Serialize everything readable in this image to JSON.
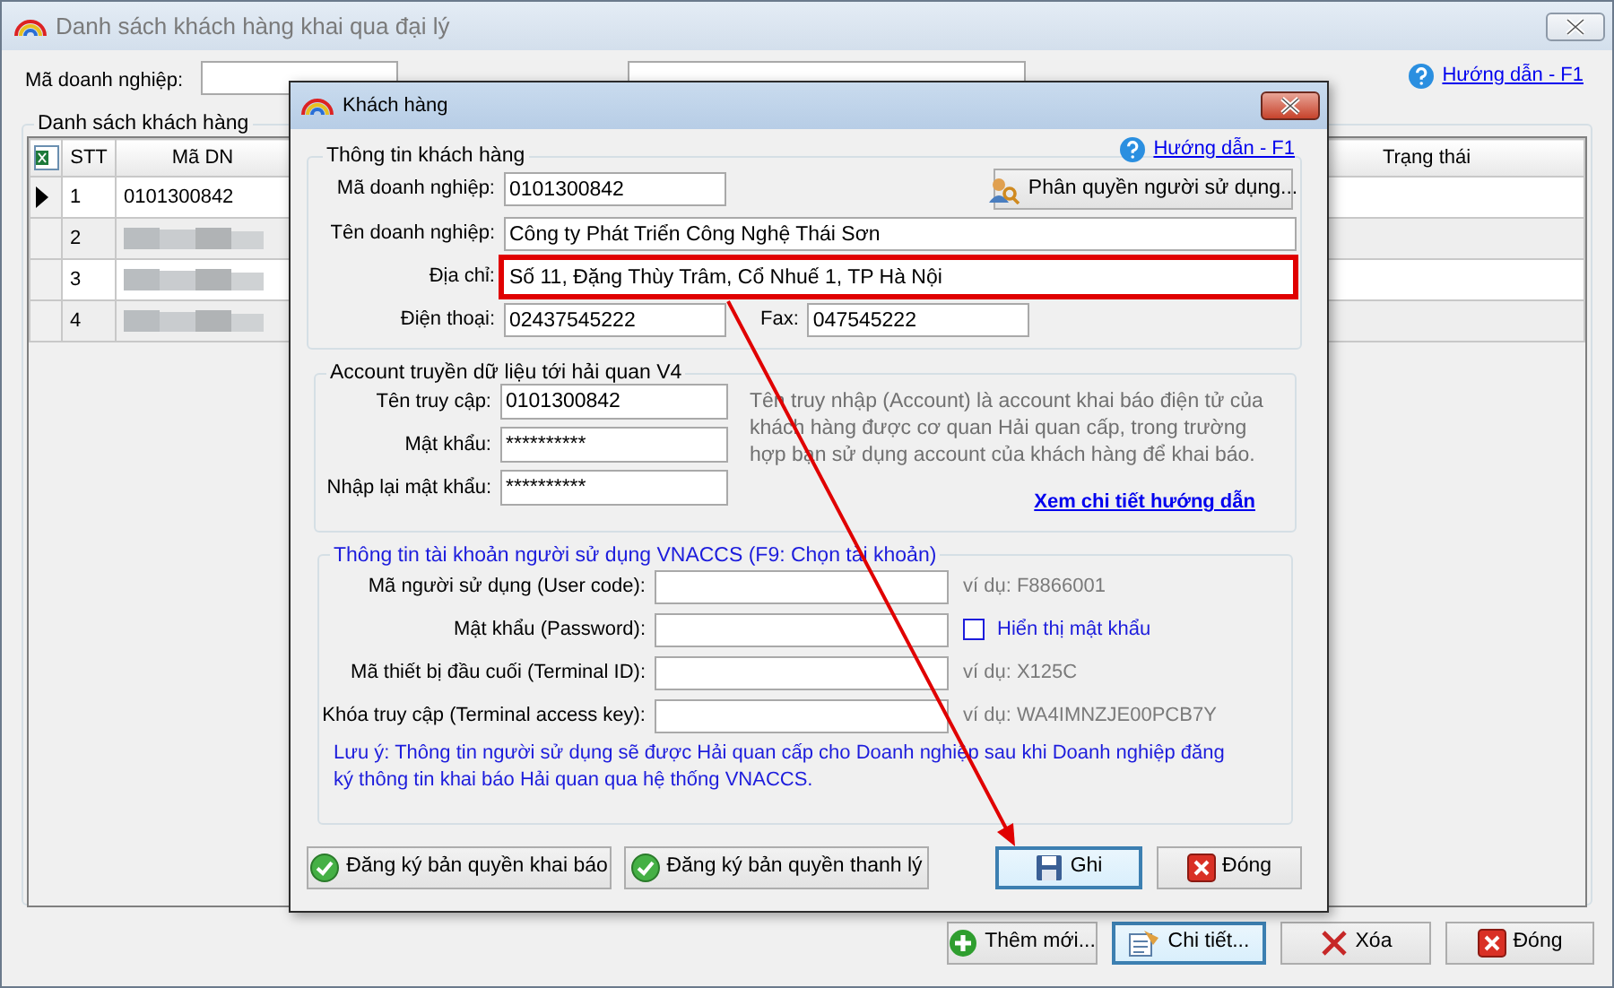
{
  "main_window": {
    "title": "Danh sách khách hàng khai qua đại lý",
    "filters": [
      {
        "label": "Mã doanh nghiệp:"
      }
    ],
    "help_link": "Hướng dẫn - F1",
    "group_title": "Danh sách khách hàng",
    "table": {
      "columns": [
        "STT",
        "Mã DN",
        "Trạng thái"
      ],
      "rows": [
        {
          "stt": "1",
          "ma_dn": "0101300842",
          "selected": true
        },
        {
          "stt": "2",
          "selected": false
        },
        {
          "stt": "3",
          "selected": false
        },
        {
          "stt": "4",
          "selected": false
        }
      ]
    },
    "buttons": [
      {
        "label": "Thêm mới...",
        "focused": false
      },
      {
        "label": "Chi tiết...",
        "focused": true
      },
      {
        "label": "Xóa",
        "focused": false
      },
      {
        "label": "Đóng",
        "focused": false
      }
    ]
  },
  "dialog": {
    "title": "Khách hàng",
    "help_link": "Hướng dẫn - F1",
    "customer_info": {
      "title": "Thông tin khách hàng",
      "company_code": {
        "label": "Mã doanh nghiệp:",
        "value": "0101300842"
      },
      "permissions_button": "Phân quyền người sử dụng...",
      "company_name": {
        "label": "Tên doanh nghiệp:",
        "value": "Công ty Phát Triển Công Nghệ Thái Sơn"
      },
      "address": {
        "label": "Địa chỉ:",
        "value": "Số 11, Đặng Thùy Trâm, Cổ Nhuế 1, TP Hà Nội",
        "highlighted": true
      },
      "phone": {
        "label": "Điện thoại:",
        "value": "02437545222"
      },
      "fax": {
        "label": "Fax:",
        "value": "047545222"
      }
    },
    "account_v4": {
      "title": "Account truyền dữ liệu tới hải quan V4",
      "fields": [
        {
          "label": "Tên truy cập:",
          "value": "0101300842"
        },
        {
          "label": "Mật khẩu:",
          "value": "**********"
        },
        {
          "label": "Nhập lại mật khẩu:",
          "value": "**********"
        }
      ],
      "description": "Tên truy nhập (Account) là account khai báo điện tử của khách hàng được cơ quan Hải quan cấp, trong trường hợp bạn sử dụng account của khách hàng để khai báo.",
      "guide_link": "Xem chi tiết hướng dẫn"
    },
    "vnaccs": {
      "title": "Thông tin tài khoản người sử dụng VNACCS (F9: Chọn tài khoản)",
      "fields": [
        {
          "label": "Mã người sử dụng (User code):",
          "kind": "hint",
          "hint": "ví dụ: F8866001"
        },
        {
          "label": "Mật khẩu (Password):",
          "kind": "checkbox",
          "checkbox_label": "Hiển thị mật khẩu",
          "checked": false
        },
        {
          "label": "Mã thiết bị đầu cuối (Terminal ID):",
          "kind": "hint",
          "hint": "ví dụ: X125C"
        },
        {
          "label": "Khóa truy cập (Terminal access key):",
          "kind": "hint",
          "hint": "ví dụ: WA4IMNZJE00PCB7Y"
        }
      ],
      "note": "Lưu ý: Thông tin người sử dụng sẽ được Hải quan cấp cho Doanh nghiệp sau khi Doanh nghiệp đăng ký thông tin khai báo Hải quan qua hệ thống VNACCS."
    },
    "buttons": [
      {
        "label": "Đăng ký bản quyền khai báo",
        "focused": false
      },
      {
        "label": "Đăng ký bản quyền thanh lý",
        "focused": false
      },
      {
        "label": "Ghi",
        "focused": true
      },
      {
        "label": "Đóng",
        "focused": false
      }
    ]
  }
}
